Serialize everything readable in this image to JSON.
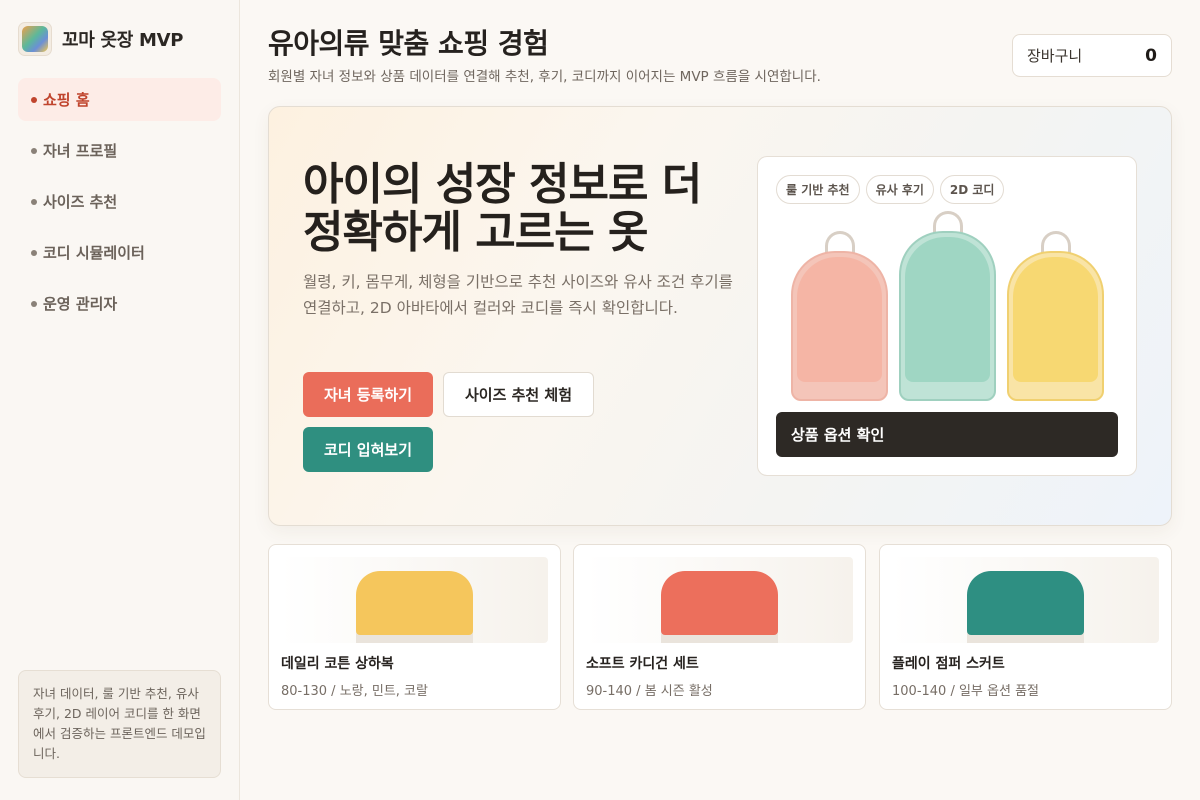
{
  "brand": {
    "name": "꼬마 옷장 MVP"
  },
  "sidebar": {
    "items": [
      {
        "label": "쇼핑 홈",
        "active": true
      },
      {
        "label": "자녀 프로필",
        "active": false
      },
      {
        "label": "사이즈 추천",
        "active": false
      },
      {
        "label": "코디 시뮬레이터",
        "active": false
      },
      {
        "label": "운영 관리자",
        "active": false
      }
    ],
    "note": "자녀 데이터, 룰 기반 추천, 유사 후기, 2D 레이어 코디를 한 화면에서 검증하는 프론트엔드 데모입니다."
  },
  "header": {
    "title": "유아의류 맞춤 쇼핑 경험",
    "subtitle": "회원별 자녀 정보와 상품 데이터를 연결해 추천, 후기, 코디까지 이어지는 MVP 흐름을 시연합니다.",
    "cart_label": "장바구니",
    "cart_count": "0"
  },
  "hero": {
    "title": "아이의 성장 정보로 더 정확하게 고르는 옷",
    "description": "월령, 키, 몸무게, 체형을 기반으로 추천 사이즈와 유사 조건 후기를 연결하고, 2D 아바타에서 컬러와 코디를 즉시 확인합니다.",
    "buttons": {
      "register": "자녀 등록하기",
      "size": "사이즈 추천 체험",
      "coordi": "코디 입혀보기"
    },
    "preview": {
      "chips": [
        "룰 기반 추천",
        "유사 후기",
        "2D 코디"
      ],
      "colors": [
        "#f5b5a5",
        "#9fd6c3",
        "#f7d872"
      ],
      "option_button": "상품 옵션 확인"
    }
  },
  "products": [
    {
      "name": "데일리 코튼 상하복",
      "meta": "80-130 / 노랑, 민트, 코랄",
      "color": "#f5c65c"
    },
    {
      "name": "소프트 카디건 세트",
      "meta": "90-140 / 봄 시즌 활성",
      "color": "#ec6f5c"
    },
    {
      "name": "플레이 점퍼 스커트",
      "meta": "100-140 / 일부 옵션 품절",
      "color": "#2e8f82"
    }
  ],
  "colors": {
    "accent": "#ea6d5a",
    "teal": "#2f8f80",
    "dark": "#2d2925"
  }
}
